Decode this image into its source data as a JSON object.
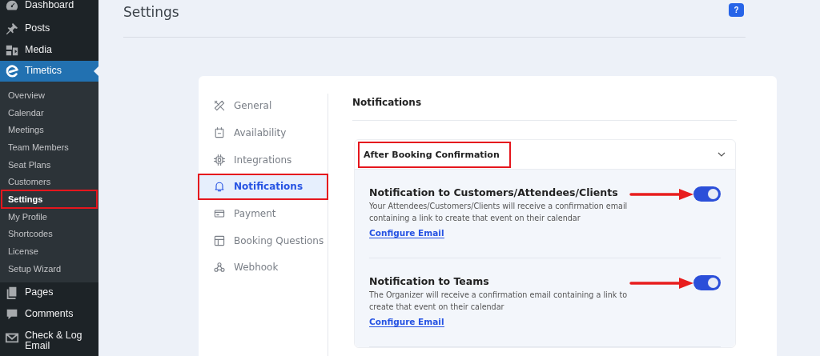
{
  "sidebar": {
    "items": [
      {
        "label": "Dashboard",
        "selected": false
      },
      {
        "label": "Posts",
        "selected": false
      },
      {
        "label": "Media",
        "selected": false
      },
      {
        "label": "Timetics",
        "selected": true,
        "children": [
          {
            "label": "Overview",
            "selected": false,
            "highlighted": false
          },
          {
            "label": "Calendar",
            "selected": false,
            "highlighted": false
          },
          {
            "label": "Meetings",
            "selected": false,
            "highlighted": false
          },
          {
            "label": "Team Members",
            "selected": false,
            "highlighted": false
          },
          {
            "label": "Seat Plans",
            "selected": false,
            "highlighted": false
          },
          {
            "label": "Customers",
            "selected": false,
            "highlighted": false
          },
          {
            "label": "Settings",
            "selected": true,
            "highlighted": true
          },
          {
            "label": "My Profile",
            "selected": false,
            "highlighted": false
          },
          {
            "label": "Shortcodes",
            "selected": false,
            "highlighted": false
          },
          {
            "label": "License",
            "selected": false,
            "highlighted": false
          },
          {
            "label": "Setup Wizard",
            "selected": false,
            "highlighted": false
          }
        ]
      },
      {
        "label": "Pages",
        "selected": false
      },
      {
        "label": "Comments",
        "selected": false
      },
      {
        "label": "Check & Log Email",
        "selected": false
      }
    ]
  },
  "page": {
    "title": "Settings",
    "help": "?"
  },
  "settings_nav": [
    {
      "label": "General",
      "selected": false,
      "highlighted": false
    },
    {
      "label": "Availability",
      "selected": false,
      "highlighted": false
    },
    {
      "label": "Integrations",
      "selected": false,
      "highlighted": false
    },
    {
      "label": "Notifications",
      "selected": true,
      "highlighted": true
    },
    {
      "label": "Payment",
      "selected": false,
      "highlighted": false
    },
    {
      "label": "Booking Questions",
      "selected": false,
      "highlighted": false
    },
    {
      "label": "Webhook",
      "selected": false,
      "highlighted": false
    }
  ],
  "section": {
    "title": "Notifications",
    "accordion": {
      "title": "After Booking Confirmation",
      "highlighted": true,
      "expanded": true,
      "items": [
        {
          "title": "Notification to Customers/Attendees/Clients",
          "description": "Your Attendees/Customers/Clients will receive a confirmation email containing a link to create that event on their calendar",
          "link": "Configure Email",
          "on": true,
          "arrow": true
        },
        {
          "title": "Notification to Teams",
          "description": "The Organizer will receive a confirmation email containing a link to create that event on their calendar",
          "link": "Configure Email",
          "on": true,
          "arrow": true
        }
      ]
    }
  }
}
